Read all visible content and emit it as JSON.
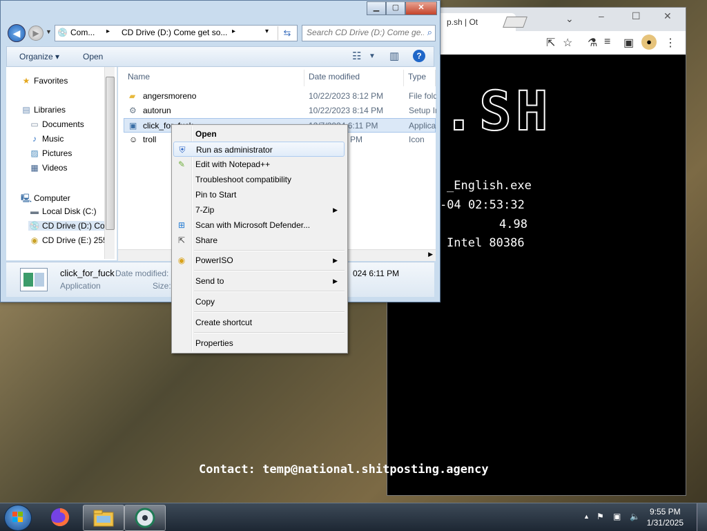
{
  "browser": {
    "tab_title": "p.sh | Ot",
    "tab_close": "✕",
    "min_btn": "–",
    "max_btn": "☐",
    "close_btn": "✕",
    "chevron": "⌄",
    "logo_text": ".SH",
    "info_lines": [
      "_English.exe",
      "-04 02:53:32",
      "4.98",
      "Intel 80386"
    ],
    "contact": "Contact: temp@national.shitposting.agency"
  },
  "explorer": {
    "min_btn": "▁",
    "max_btn": "▢",
    "close_btn": "✕",
    "address": {
      "seg1": "Com...",
      "sep1": "▸",
      "seg2": "CD Drive (D:) Come get so...",
      "sep2": "▸",
      "dropdown": "▾"
    },
    "search_placeholder": "Search CD Drive (D:) Come ge...",
    "toolbar": {
      "organize": "Organize ▾",
      "open": "Open"
    },
    "nav": {
      "favorites": "Favorites",
      "libraries": "Libraries",
      "documents": "Documents",
      "music": "Music",
      "pictures": "Pictures",
      "videos": "Videos",
      "computer": "Computer",
      "local_disk": "Local Disk (C:)",
      "cd_d": "CD Drive (D:) Co",
      "cd_e": "CD Drive (E:) 255"
    },
    "columns": {
      "name": "Name",
      "date": "Date modified",
      "type": "Type"
    },
    "files": [
      {
        "name": "angersmoreno",
        "date": "10/22/2023 8:12 PM",
        "type": "File fold"
      },
      {
        "name": "autorun",
        "date": "10/22/2023 8:14 PM",
        "type": "Setup In"
      },
      {
        "name": "click_for_fuck",
        "date": "12/7/2024 6:11 PM",
        "type": "Applica"
      },
      {
        "name": "troll",
        "date": "/2023 8:14 PM",
        "type": "Icon"
      }
    ],
    "details": {
      "name": "click_for_fuck",
      "type": "Application",
      "date_label": "Date modified:",
      "date_value": "024 6:11 PM",
      "size_label": "Size:"
    }
  },
  "context_menu": {
    "open": "Open",
    "run_admin": "Run as administrator",
    "edit_npp": "Edit with Notepad++",
    "troubleshoot": "Troubleshoot compatibility",
    "pin_start": "Pin to Start",
    "zip": "7-Zip",
    "defender": "Scan with Microsoft Defender...",
    "share": "Share",
    "poweriso": "PowerISO",
    "send_to": "Send to",
    "copy": "Copy",
    "create_shortcut": "Create shortcut",
    "properties": "Properties"
  },
  "taskbar": {
    "time": "9:55 PM",
    "date": "1/31/2025",
    "tray_arrow": "▲"
  }
}
